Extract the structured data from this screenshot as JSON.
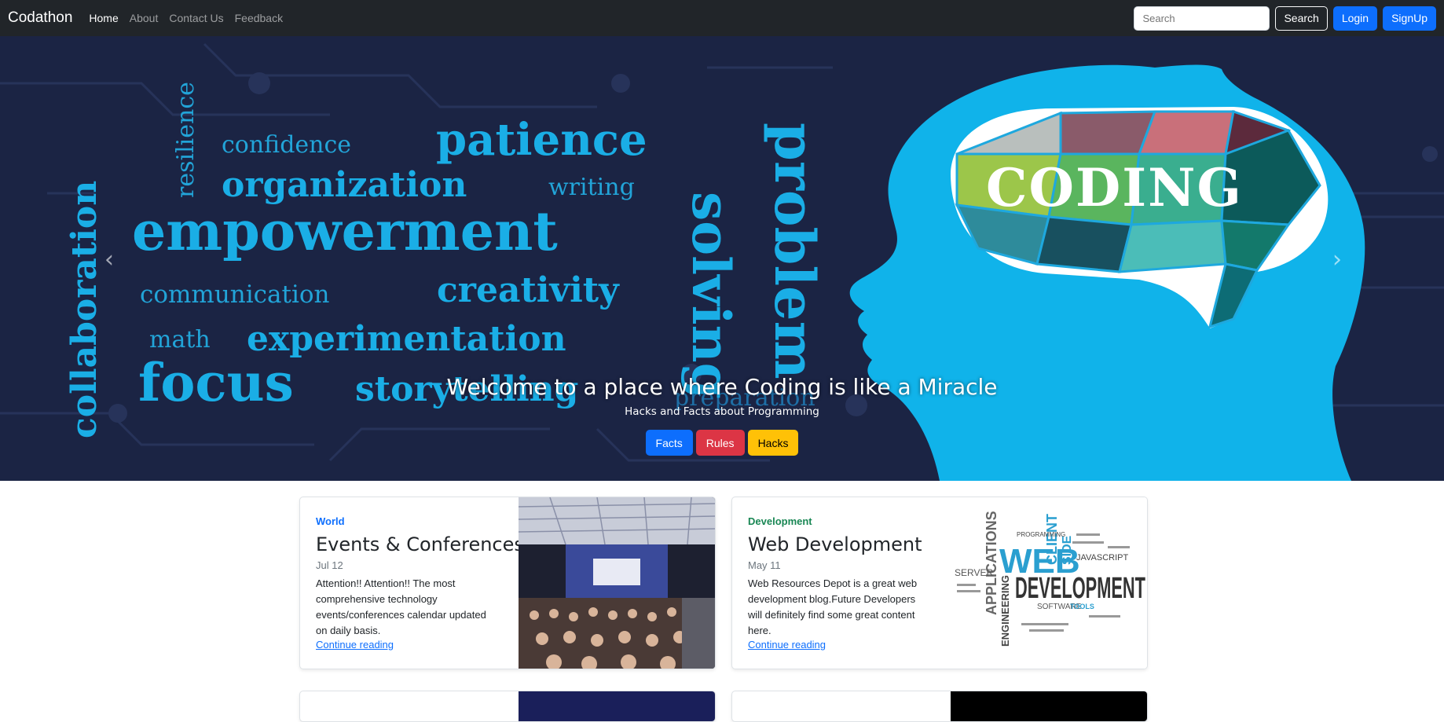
{
  "navbar": {
    "brand": "Codathon",
    "links": [
      "Home",
      "About",
      "Contact Us",
      "Feedback"
    ],
    "search_placeholder": "Search",
    "search_button": "Search",
    "login_button": "Login",
    "signup_button": "SignUp"
  },
  "carousel": {
    "words": [
      "confidence",
      "patience",
      "resilience",
      "organization",
      "writing",
      "empowerment",
      "communication",
      "creativity",
      "math",
      "experimentation",
      "focus",
      "storytelling",
      "preparation",
      "collaboration",
      "solving",
      "problem"
    ],
    "badge_word": "CODING",
    "caption_title": "Welcome to a place where Coding is like a Miracle",
    "caption_sub": "Hacks and Facts about Programming",
    "buttons": [
      "Facts",
      "Rules",
      "Hacks"
    ],
    "prev_icon": "‹",
    "next_icon": "›"
  },
  "cards": [
    {
      "category": "World",
      "category_color": "#0d6efd",
      "title": "Events & Conferences",
      "date": "Jul 12",
      "text": "Attention!! Attention!! The most comprehensive technology events/conferences calendar updated on daily basis.",
      "link": "Continue reading"
    },
    {
      "category": "Development",
      "category_color": "#198754",
      "title": "Web Development",
      "date": "May 11",
      "text": "Web Resources Depot is a great web development blog.Future Developers will definitely find some great content here.",
      "link": "Continue reading",
      "image_words": [
        "WEB",
        "DEVELOPMENT",
        "CLIENT",
        "SIDE",
        "APPLICATIONS",
        "ENGINEERING",
        "SERVER",
        "JAVASCRIPT",
        "SOFTWARE",
        "TOOLS",
        "PROGRAMMING"
      ]
    }
  ]
}
